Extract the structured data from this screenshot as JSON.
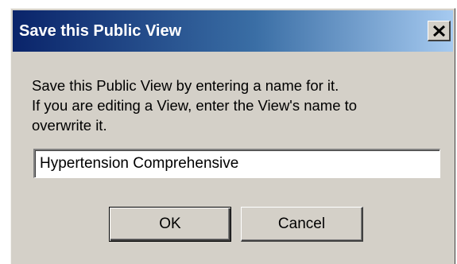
{
  "dialog": {
    "title": "Save this Public View",
    "close_icon": "close-icon",
    "message_lines": [
      "Save this Public View by entering a name for it.",
      "If you are editing a View, enter the View's name to",
      "overwrite it."
    ],
    "name_input": {
      "value": "Hypertension Comprehensive"
    },
    "ok_label": "OK",
    "cancel_label": "Cancel"
  }
}
